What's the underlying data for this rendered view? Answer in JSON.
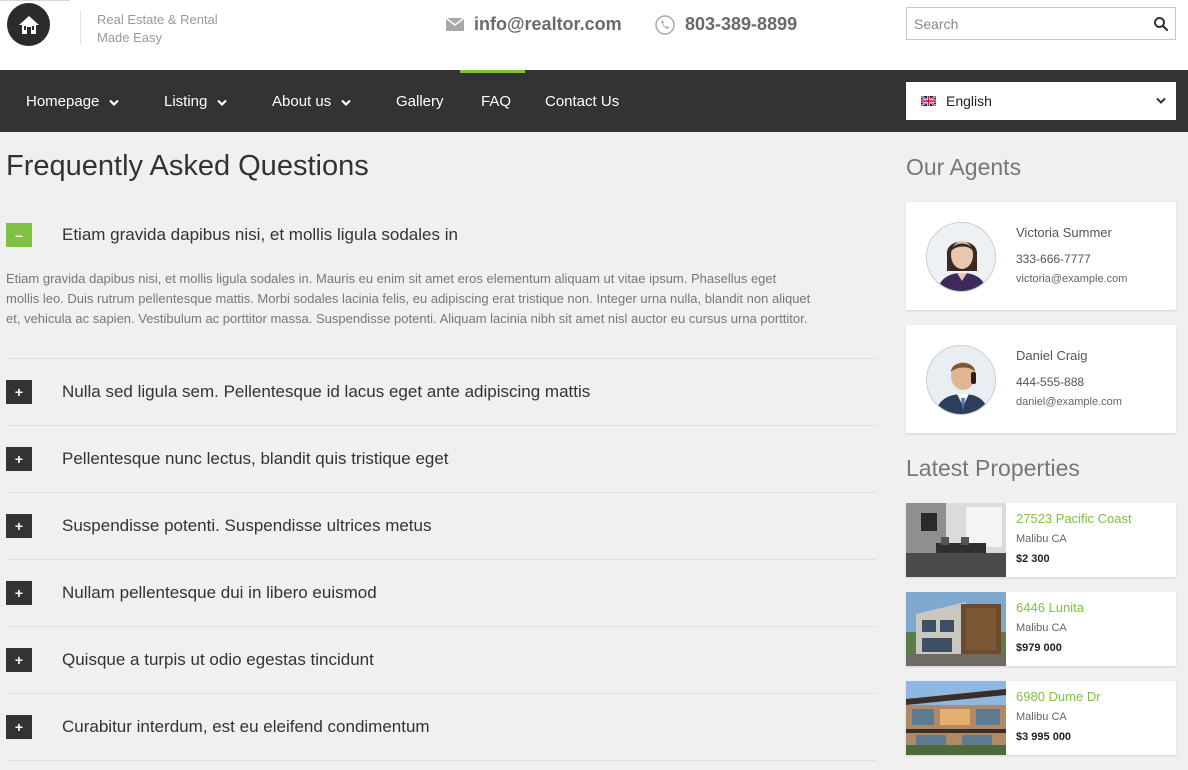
{
  "header": {
    "tagline_line1": "Real Estate & Rental",
    "tagline_line2": "Made Easy",
    "email": "info@realtor.com",
    "phone": "803-389-8899",
    "search_placeholder": "Search"
  },
  "nav": {
    "items": [
      {
        "label": "Homepage",
        "has_dropdown": true
      },
      {
        "label": "Listing",
        "has_dropdown": true
      },
      {
        "label": "About us",
        "has_dropdown": true
      },
      {
        "label": "Gallery",
        "has_dropdown": false
      },
      {
        "label": "FAQ",
        "has_dropdown": false,
        "active": true
      },
      {
        "label": "Contact Us",
        "has_dropdown": false
      }
    ],
    "language": "English",
    "language_flag_icon": "uk-flag-icon"
  },
  "faq": {
    "title": "Frequently Asked Questions",
    "items": [
      {
        "question": "Etiam gravida dapibus nisi, et mollis ligula sodales in",
        "expanded": true,
        "answer_lines": [
          "Etiam gravida dapibus nisi, et mollis ligula sodales in. Mauris eu enim sit amet eros elementum aliquam ut vitae ipsum. Phasellus eget",
          "mollis leo. Duis rutrum pellentesque mattis. Morbi sodales lacinia felis, eu adipiscing erat tristique non. Integer urna nulla, blandit non aliquet",
          "et, vehicula ac sapien. Vestibulum ac porttitor massa. Suspendisse potenti. Aliquam lacinia nibh sit amet nisl auctor eu cursus urna porttitor."
        ]
      },
      {
        "question": "Nulla sed ligula sem. Pellentesque id lacus eget ante adipiscing mattis",
        "expanded": false
      },
      {
        "question": "Pellentesque nunc lectus, blandit quis tristique eget",
        "expanded": false
      },
      {
        "question": "Suspendisse potenti. Suspendisse ultrices metus",
        "expanded": false
      },
      {
        "question": "Nullam pellentesque dui in libero euismod",
        "expanded": false
      },
      {
        "question": "Quisque a turpis ut odio egestas tincidunt",
        "expanded": false
      },
      {
        "question": "Curabitur interdum, est eu eleifend condimentum",
        "expanded": false
      }
    ],
    "toggle_open_symbol": "–",
    "toggle_closed_symbol": "+"
  },
  "sidebar": {
    "agents_title": "Our Agents",
    "agents": [
      {
        "name": "Victoria Summer",
        "phone": "333-666-7777",
        "email": "victoria@example.com"
      },
      {
        "name": "Daniel Craig",
        "phone": "444-555-888",
        "email": "daniel@example.com"
      }
    ],
    "properties_title": "Latest Properties",
    "properties": [
      {
        "address": "27523 Pacific Coast",
        "city": "Malibu CA",
        "price": "$2 300"
      },
      {
        "address": "6446 Lunita",
        "city": "Malibu CA",
        "price": "$979 000"
      },
      {
        "address": "6980 Dume Dr",
        "city": "Malibu CA",
        "price": "$3 995 000"
      }
    ]
  },
  "colors": {
    "accent": "#7dc242",
    "nav_bg": "#333333",
    "page_bg": "#f0f0f0"
  }
}
